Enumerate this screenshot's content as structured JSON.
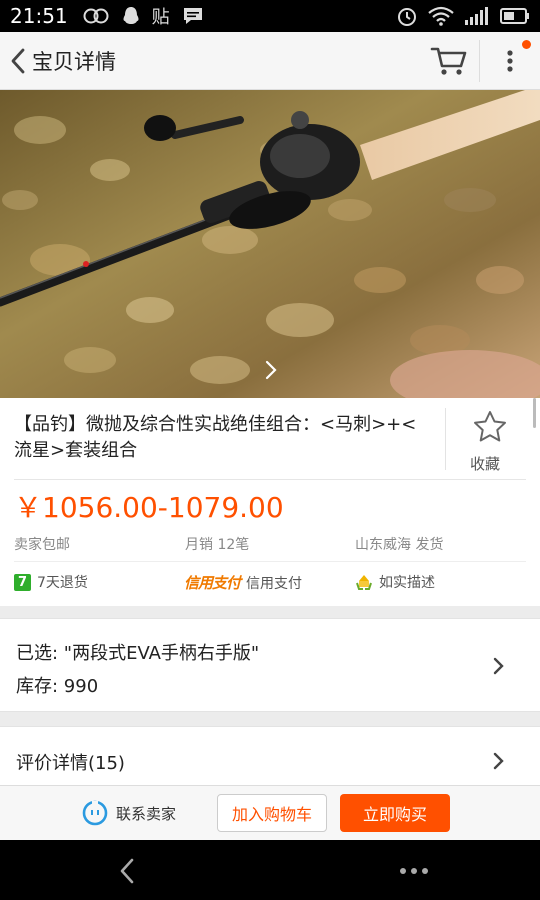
{
  "status_bar": {
    "time": "21:51",
    "app_glyph": "贴"
  },
  "header": {
    "title": "宝贝详情"
  },
  "product": {
    "title": "【品钓】微抛及综合性实战绝佳组合：<马刺>+<流星>套装组合",
    "favorite_label": "收藏",
    "price": "￥1056.00-1079.00",
    "shipping": "卖家包邮",
    "monthly_sales": "月销 12笔",
    "ship_from": "山东威海 发货",
    "services": [
      {
        "icon": "7",
        "label": "7天退货"
      },
      {
        "icon": "credit-pay-logo",
        "logo_text": "信用支付",
        "label": "信用支付"
      },
      {
        "icon": "honest-desc-icon",
        "label": "如实描述"
      }
    ]
  },
  "sku": {
    "selected": "已选: \"两段式EVA手柄右手版\"",
    "stock": "库存: 990"
  },
  "reviews": {
    "label": "评价详情(15)"
  },
  "actions": {
    "contact_seller": "联系卖家",
    "add_to_cart": "加入购物车",
    "buy_now": "立即购买"
  },
  "colors": {
    "accent": "#ff5000",
    "service_green": "#2fae2c",
    "credit_orange": "#f07a00"
  }
}
